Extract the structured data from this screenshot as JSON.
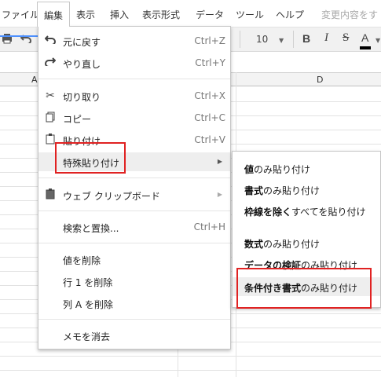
{
  "menubar": {
    "file": "ファイル",
    "edit": "編集",
    "view": "表示",
    "insert": "挿入",
    "format": "表示形式",
    "data": "データ",
    "tools": "ツール",
    "help": "ヘルプ",
    "save_status": "変更内容をす"
  },
  "toolbar": {
    "font_size": "10",
    "bold": "B",
    "italic": "I",
    "strike": "S",
    "text_color": "A",
    "text_color_value": "#000000"
  },
  "grid": {
    "col_a": "A",
    "col_d": "D"
  },
  "edit_menu": {
    "undo": {
      "label": "元に戻す",
      "shortcut": "Ctrl+Z"
    },
    "redo": {
      "label": "やり直し",
      "shortcut": "Ctrl+Y"
    },
    "cut": {
      "label": "切り取り",
      "shortcut": "Ctrl+X"
    },
    "copy": {
      "label": "コピー",
      "shortcut": "Ctrl+C"
    },
    "paste": {
      "label": "貼り付け",
      "shortcut": "Ctrl+V"
    },
    "paste_special": {
      "label": "特殊貼り付け"
    },
    "web_clipboard": {
      "label": "ウェブ クリップボード"
    },
    "find_replace": {
      "label": "検索と置換...",
      "shortcut": "Ctrl+H"
    },
    "delete_values": {
      "label": "値を削除"
    },
    "delete_row": {
      "label": "行 1 を削除"
    },
    "delete_column": {
      "label": "列 A を削除"
    },
    "clear_notes": {
      "label": "メモを消去"
    }
  },
  "paste_special_menu": {
    "values_only": {
      "bold": "値",
      "rest": "のみ貼り付け"
    },
    "format_only": {
      "bold": "書式",
      "rest": "のみ貼り付け"
    },
    "all_except_borders": {
      "bold": "枠線を除く",
      "rest": "すべてを貼り付け"
    },
    "formula_only": {
      "bold": "数式",
      "rest": "のみ貼り付け"
    },
    "data_validation_only": {
      "bold": "データの検証",
      "rest": "のみ貼り付け"
    },
    "conditional_format_only": {
      "bold": "条件付き書式",
      "rest": "のみ貼り付け"
    }
  },
  "colors": {
    "highlight_box": "#e02222",
    "selection": "#4d90fe"
  }
}
